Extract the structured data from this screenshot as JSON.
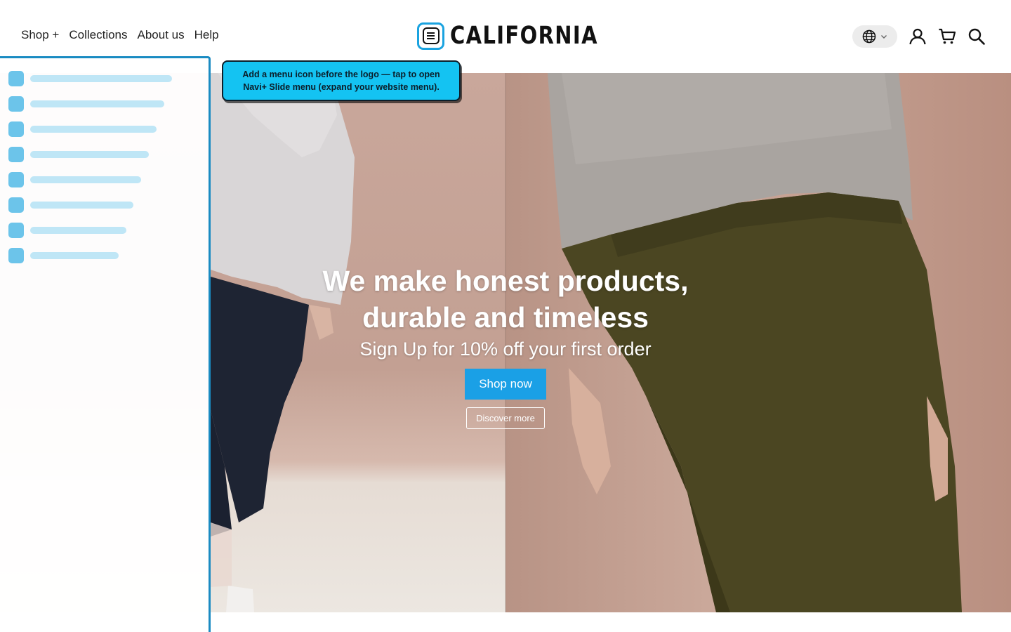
{
  "header": {
    "nav": [
      "Shop +",
      "Collections",
      "About us",
      "Help"
    ],
    "logo_text": "CALIFORNIA",
    "icons": [
      "menu-icon",
      "globe-icon",
      "chevron-down-icon",
      "user-icon",
      "cart-icon",
      "search-icon"
    ]
  },
  "tooltip": {
    "text_line1": "Add a menu icon before the logo — tap to open",
    "text_line2": "Navi+ Slide menu (expand your website menu)."
  },
  "hero": {
    "headline_line1": "We make honest products,",
    "headline_line2": "durable and timeless",
    "subline": "Sign Up for 10% off your first order",
    "shop_button": "Shop now",
    "discover_button": "Discover more"
  },
  "colors": {
    "accent": "#1aa0e6",
    "tooltip_bg": "#14c3f2",
    "panel_border": "#1a8bc2"
  }
}
